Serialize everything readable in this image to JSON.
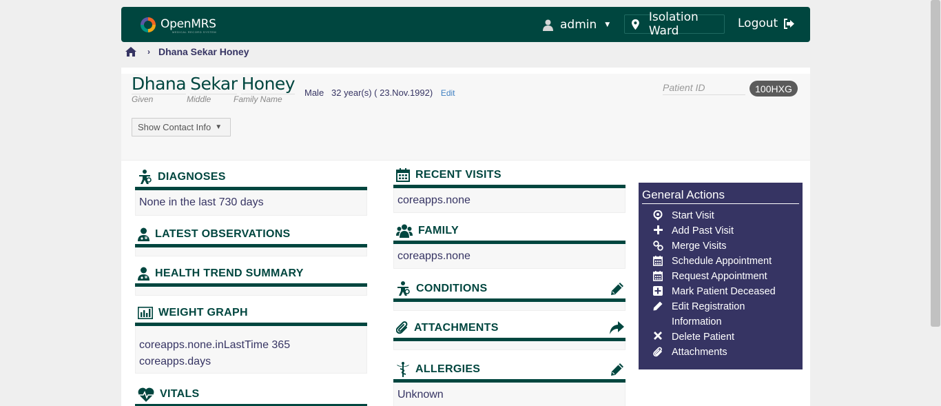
{
  "header": {
    "logo_text": "OpenMRS",
    "logo_sub": "MEDICAL RECORD SYSTEM",
    "user": "admin",
    "location": "Isolation Ward",
    "logout": "Logout"
  },
  "breadcrumb": {
    "patient": "Dhana Sekar Honey"
  },
  "patient": {
    "given": "Dhana",
    "middle": "Sekar",
    "family": "Honey",
    "given_label": "Given",
    "middle_label": "Middle",
    "family_label": "Family Name",
    "gender": "Male",
    "age": "32 year(s) ( 23.Nov.1992)",
    "edit": "Edit",
    "contact_button": "Show Contact Info",
    "id_label": "Patient ID",
    "id_value": "100HXG"
  },
  "left_widgets": {
    "diagnoses": {
      "title": "Diagnoses",
      "body": "None in the last 730 days"
    },
    "latest_obs": {
      "title": "Latest Observations"
    },
    "health_trend": {
      "title": "Health Trend Summary"
    },
    "weight_graph": {
      "title": "Weight Graph",
      "line1": "coreapps.none.inLastTime 365",
      "line2": "coreapps.days"
    },
    "vitals": {
      "title": "Vitals"
    }
  },
  "mid_widgets": {
    "recent_visits": {
      "title": "Recent Visits",
      "body": "coreapps.none"
    },
    "family": {
      "title": "Family",
      "body": "coreapps.none"
    },
    "conditions": {
      "title": "Conditions"
    },
    "attachments": {
      "title": "Attachments"
    },
    "allergies": {
      "title": "Allergies",
      "body": "Unknown"
    }
  },
  "general_actions": {
    "title": "General Actions",
    "items": [
      "Start Visit",
      "Add Past Visit",
      "Merge Visits",
      "Schedule Appointment",
      "Request Appointment",
      "Mark Patient Deceased",
      "Edit Registration Information",
      "Delete Patient",
      "Attachments"
    ]
  },
  "colors": {
    "primary": "#00463f",
    "actions_bg": "#363463",
    "badge": "#5b5b5b",
    "link": "#3e7fc1"
  }
}
